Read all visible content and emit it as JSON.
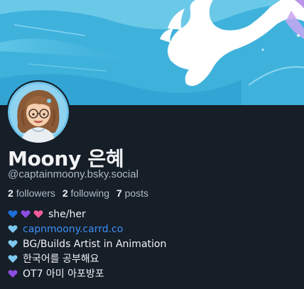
{
  "profile": {
    "display_name": "Moony 은혜",
    "handle": "@captainmoony.bsky.social"
  },
  "stats": {
    "followers_count": "2",
    "followers_label": "followers",
    "following_count": "2",
    "following_label": "following",
    "posts_count": "7",
    "posts_label": "posts"
  },
  "bio": {
    "line1_text": "she/her",
    "line1_hearts": [
      "blue-heart",
      "purple-heart",
      "pink-heart"
    ],
    "line2_link": "capnmoony.carrd.co",
    "line2_hearts": [
      "light-blue-heart"
    ],
    "line3_text": "BG/Builds Artist in Animation",
    "line3_hearts": [
      "light-blue-heart"
    ],
    "line4_text": "한국어를 공부해요",
    "line4_hearts": [
      "light-blue-heart"
    ],
    "line5_text": "OT7 아미 아포방포",
    "line5_hearts": [
      "purple-heart"
    ]
  },
  "colors": {
    "background": "#161e27",
    "text": "#f1f3f5",
    "muted": "#aebbc9",
    "link": "#3d8ff6",
    "banner": "#42b4dc",
    "blue_heart": "#1d6fd6",
    "purple_heart": "#8b4ee0",
    "pink_heart": "#f25c9a",
    "light_blue_heart": "#7dc8f0"
  }
}
